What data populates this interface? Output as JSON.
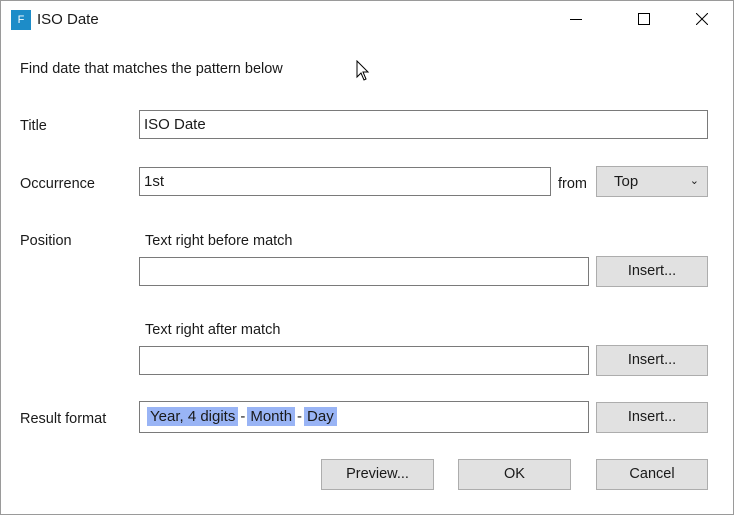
{
  "window": {
    "icon_text": "F",
    "title": "ISO Date"
  },
  "colors": {
    "icon_bg": "#1d8cc8",
    "token_highlight": "#99b4f5",
    "button_bg": "#e1e1e1"
  },
  "icons": [
    "app-icon",
    "minimize-icon",
    "maximize-icon",
    "close-icon",
    "chevron-down-icon",
    "mouse-cursor-icon"
  ],
  "form": {
    "heading": "Find date that matches the pattern below",
    "title_label": "Title",
    "title_value": "ISO Date",
    "occurrence_label": "Occurrence",
    "occurrence_value": "1st",
    "from_label": "from",
    "from_selected": "Top",
    "position_label": "Position",
    "before_label": "Text right before match",
    "before_value": "",
    "after_label": "Text right after match",
    "after_value": "",
    "result_label": "Result format",
    "result_tokens": [
      "Year, 4 digits",
      "Month",
      "Day"
    ],
    "result_separator": "-",
    "insert_label": "Insert..."
  },
  "actions": {
    "preview": "Preview...",
    "ok": "OK",
    "cancel": "Cancel"
  }
}
